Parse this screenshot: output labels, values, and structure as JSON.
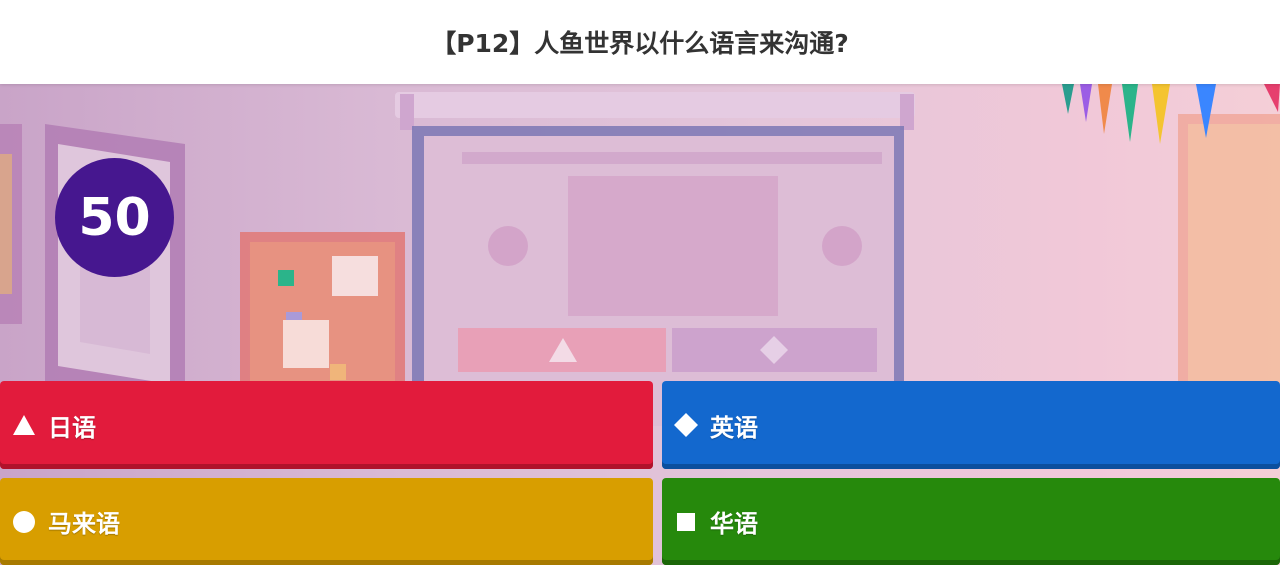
{
  "question": {
    "text": "【P12】人鱼世界以什么语言来沟通?"
  },
  "timer": {
    "value": "50",
    "color": "#46178f"
  },
  "answers": [
    {
      "label": "日语",
      "shape": "triangle-icon",
      "color": "#e21b3c"
    },
    {
      "label": "英语",
      "shape": "diamond-icon",
      "color": "#1368ce"
    },
    {
      "label": "马来语",
      "shape": "circle-icon",
      "color": "#d89e00"
    },
    {
      "label": "华语",
      "shape": "square-icon",
      "color": "#26890c"
    }
  ]
}
